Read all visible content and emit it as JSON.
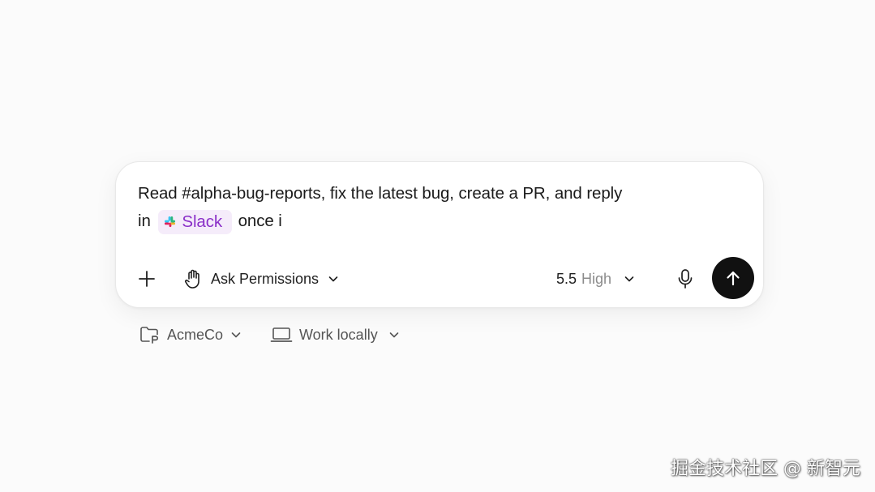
{
  "composer": {
    "prompt_line1": "Read #alpha-bug-reports, fix the latest bug, create a PR, and reply",
    "prompt_line2_prefix": "in",
    "mention_label": "Slack",
    "prompt_line2_suffix": "once i"
  },
  "toolbar": {
    "add_icon": "plus-icon",
    "permission_label": "Ask Permissions",
    "permission_icon": "hand-icon",
    "model_version": "5.5",
    "model_level": "High",
    "mic_icon": "microphone-icon",
    "send_icon": "arrow-up-icon"
  },
  "context": {
    "project_label": "AcmeCo",
    "project_icon": "folder-git-icon",
    "environment_label": "Work locally",
    "environment_icon": "laptop-icon"
  },
  "watermark": "掘金技术社区 @ 新智元",
  "colors": {
    "mention_bg": "#f5ecfa",
    "mention_text": "#8a2fc8",
    "send_button": "#111111"
  }
}
